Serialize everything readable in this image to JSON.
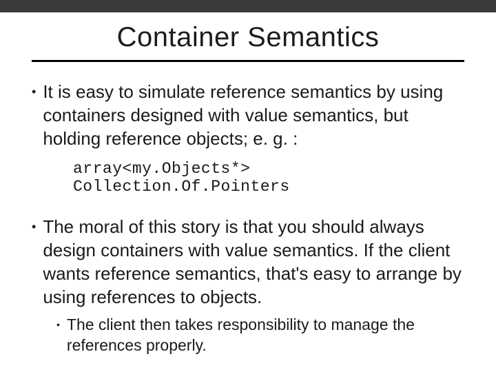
{
  "slide": {
    "title": "Container Semantics",
    "bullets": [
      {
        "text": "It is easy to simulate reference semantics by using containers designed with value semantics, but holding reference objects; e. g. :",
        "code": "array<my.Objects*> Collection.Of.Pointers"
      },
      {
        "text": "The moral of this story is that you should always design containers with value semantics. If the client wants reference semantics, that's easy to arrange by using references to objects.",
        "sub": [
          "The client then takes responsibility to manage the references properly."
        ]
      }
    ]
  }
}
